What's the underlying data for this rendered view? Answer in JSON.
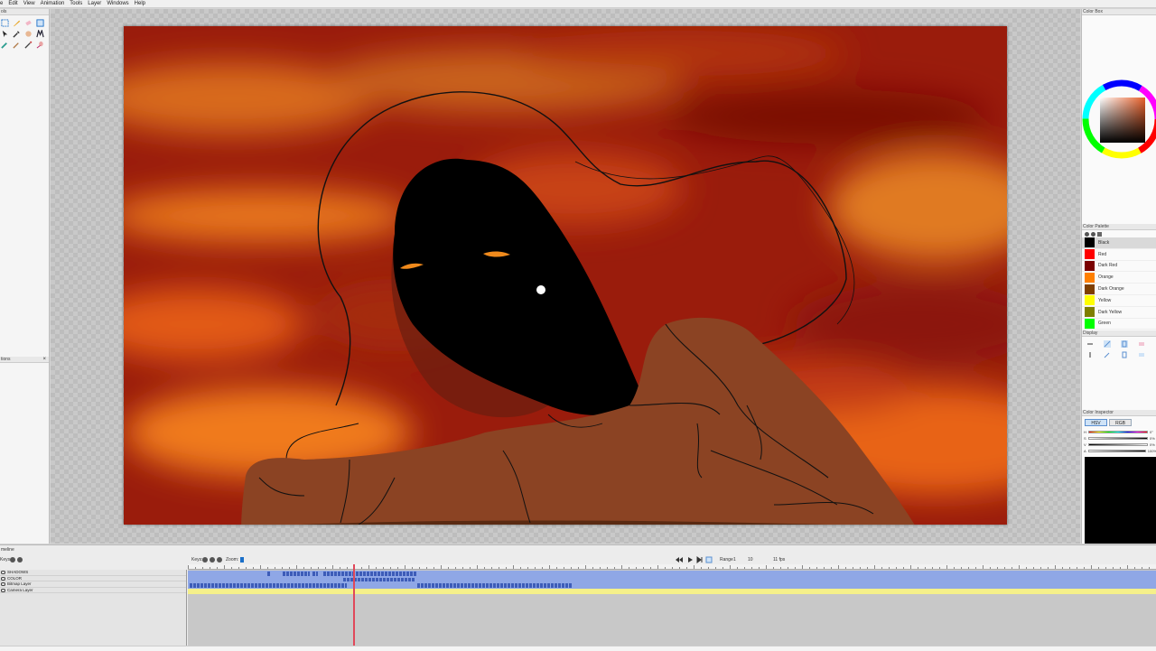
{
  "menu": [
    "e",
    "Edit",
    "View",
    "Animation",
    "Tools",
    "Layer",
    "Windows",
    "Help"
  ],
  "left_panel": {
    "tools_title": "ols",
    "options_title": "tions",
    "close_glyph": "×",
    "tools": [
      "select-tool-icon",
      "pen-tool-icon",
      "eraser-tool-icon",
      "transform-tool-icon",
      "pointer-tool-icon",
      "eyedropper-tool-icon",
      "hand-tool-icon",
      "magic-wand-tool-icon",
      "brush-tool-icon",
      "paint-tool-icon",
      "pencil-tool-icon",
      "smudge-tool-icon"
    ]
  },
  "right_panels": {
    "color_box_title": "Color Box",
    "palette_title": "Color Palette",
    "palette": [
      {
        "name": "Black",
        "color": "#000000"
      },
      {
        "name": "Red",
        "color": "#ff0000"
      },
      {
        "name": "Dark Red",
        "color": "#7a0000"
      },
      {
        "name": "Orange",
        "color": "#ff7f00"
      },
      {
        "name": "Dark Orange",
        "color": "#7f3f00"
      },
      {
        "name": "Yellow",
        "color": "#ffff00"
      },
      {
        "name": "Dark Yellow",
        "color": "#7f7f00"
      },
      {
        "name": "Green",
        "color": "#00ff00"
      }
    ],
    "display_title": "Display",
    "inspector_title": "Color Inspector",
    "inspector_tabs": [
      "HSV",
      "RGB"
    ],
    "sliders": [
      {
        "letter": "H",
        "value": "0°"
      },
      {
        "letter": "S",
        "value": "0%"
      },
      {
        "letter": "V",
        "value": "0%"
      },
      {
        "letter": "A",
        "value": "100%"
      }
    ],
    "current_color": "#000000"
  },
  "timeline": {
    "title": "meline",
    "keys_label": "Keys:",
    "zoom_label": "Zoom:",
    "range_label": "Range",
    "range_start": "1",
    "range_end": "10",
    "fps": "11 fps",
    "layers": [
      "SHADOWS",
      "COLOR",
      "Bitmap Layer",
      "Camera Layer"
    ],
    "current_frame": 46
  },
  "colors": {
    "accent": "#5a8fd0",
    "playhead": "#e0485a",
    "track_blue": "#8fa7e6",
    "track_yellow": "#f5f08a"
  }
}
